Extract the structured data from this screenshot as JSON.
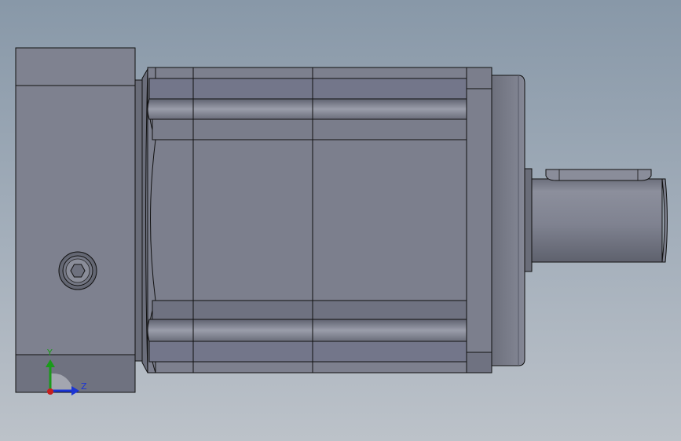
{
  "view": {
    "background_top": "#8898a8",
    "background_bottom": "#bcc2c9"
  },
  "model": {
    "body_color": "#7b7e8d",
    "edge_color": "#111111"
  },
  "triad": {
    "y_label": "Y",
    "z_label": "Z",
    "y_color": "#1a9a1a",
    "z_color": "#1b35d4",
    "x_color": "#c81e1e"
  }
}
